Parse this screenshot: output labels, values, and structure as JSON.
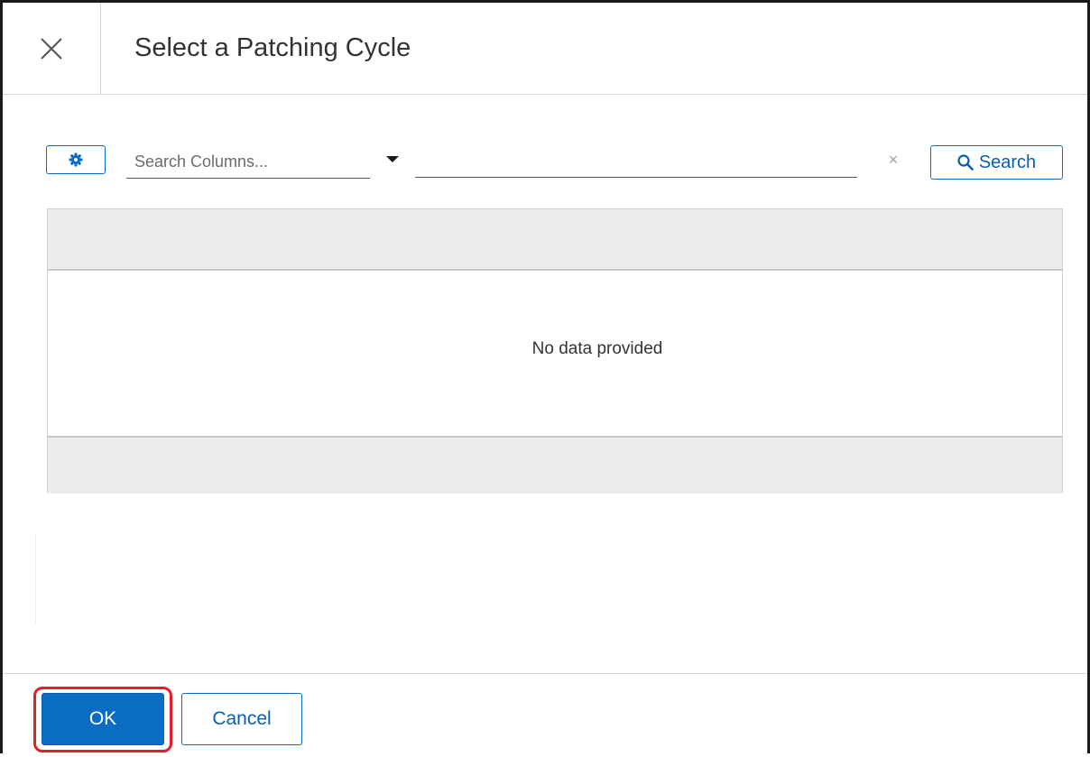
{
  "dialog": {
    "title": "Select a Patching Cycle",
    "close_icon": "close-icon"
  },
  "toolbar": {
    "settings_icon": "gear-icon",
    "column_select": {
      "placeholder": "Search Columns...",
      "dropdown_icon": "caret-down-icon"
    },
    "search_input": {
      "value": "",
      "placeholder": ""
    },
    "clear_label": "×",
    "search_button": {
      "label": "Search",
      "icon": "search-icon"
    }
  },
  "grid": {
    "empty_message": "No data provided"
  },
  "footer": {
    "ok_label": "OK",
    "cancel_label": "Cancel"
  },
  "colors": {
    "accent": "#0a6cc2",
    "highlight": "#e0202a",
    "header_gray": "#ececec"
  }
}
